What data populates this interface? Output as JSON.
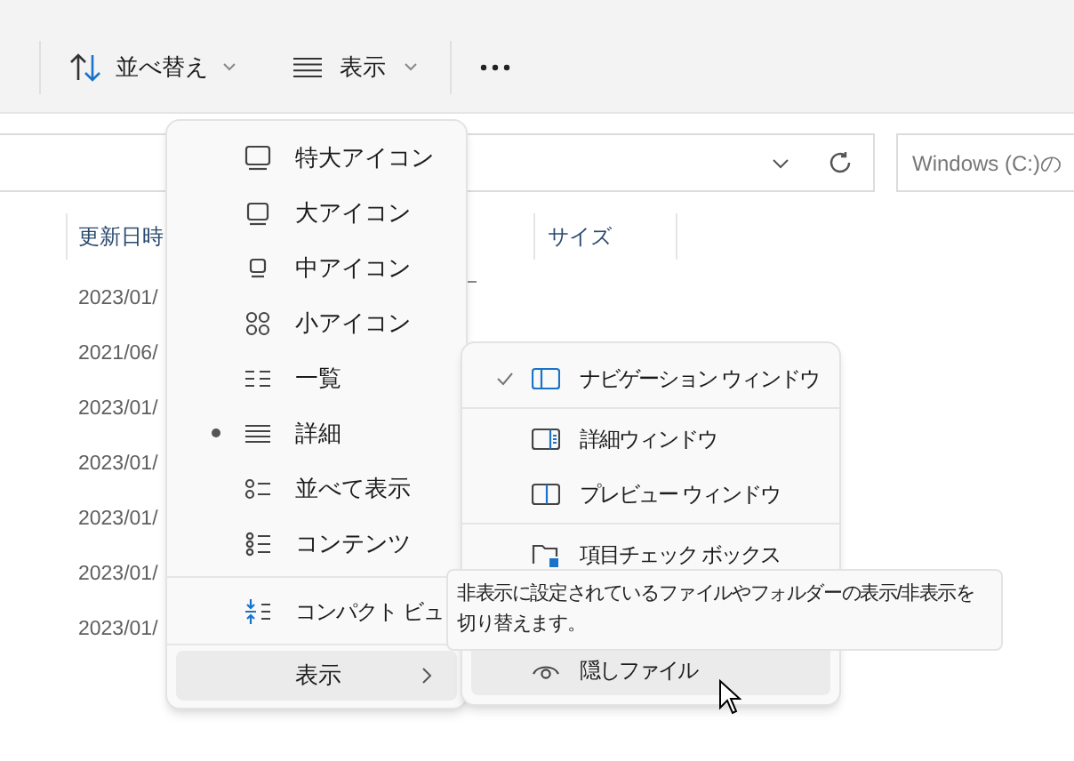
{
  "toolbar": {
    "sort_button": {
      "label": "並べ替え"
    },
    "view_button": {
      "label": "表示"
    }
  },
  "search_field": {
    "placeholder": "Windows (C:)の"
  },
  "columns": [
    "更新日時",
    "サイズ"
  ],
  "rows": [
    "2023/01/",
    "2021/06/",
    "2023/01/",
    "2023/01/",
    "2023/01/",
    "2023/01/",
    "2023/01/"
  ],
  "view_menu": [
    {
      "kind": "layout",
      "label": "特大アイコン",
      "selected": false
    },
    {
      "kind": "layout",
      "label": "大アイコン",
      "selected": false
    },
    {
      "kind": "layout",
      "label": "中アイコン",
      "selected": false
    },
    {
      "kind": "layout",
      "label": "小アイコン",
      "selected": false
    },
    {
      "kind": "layout",
      "label": "一覧",
      "selected": false
    },
    {
      "kind": "layout",
      "label": "詳細",
      "selected": true
    },
    {
      "kind": "layout",
      "label": "並べて表示",
      "selected": false
    },
    {
      "kind": "layout",
      "label": "コンテンツ",
      "selected": false
    },
    {
      "kind": "separator"
    },
    {
      "kind": "toggle",
      "label": "コンパクト ビュ",
      "checked": false
    },
    {
      "kind": "separator"
    },
    {
      "kind": "submenu",
      "label": "表示",
      "selected": true
    }
  ],
  "show_submenu": [
    {
      "kind": "toggle",
      "label": "ナビゲーション ウィンドウ",
      "checked": true,
      "selected": false
    },
    {
      "kind": "separator"
    },
    {
      "kind": "toggle",
      "label": "詳細ウィンドウ",
      "checked": false,
      "selected": false
    },
    {
      "kind": "toggle",
      "label": "プレビュー ウィンドウ",
      "checked": false,
      "selected": false
    },
    {
      "kind": "separator"
    },
    {
      "kind": "toggle",
      "label": "項目チェック ボックス",
      "checked": false,
      "selected": false
    },
    {
      "kind": "hidden"
    },
    {
      "kind": "toggle",
      "label": "隠しファイル",
      "checked": false,
      "selected": true
    }
  ],
  "tooltip": "非表示に設定されているファイルやフォルダーの表示/非表示を切り替えます。"
}
